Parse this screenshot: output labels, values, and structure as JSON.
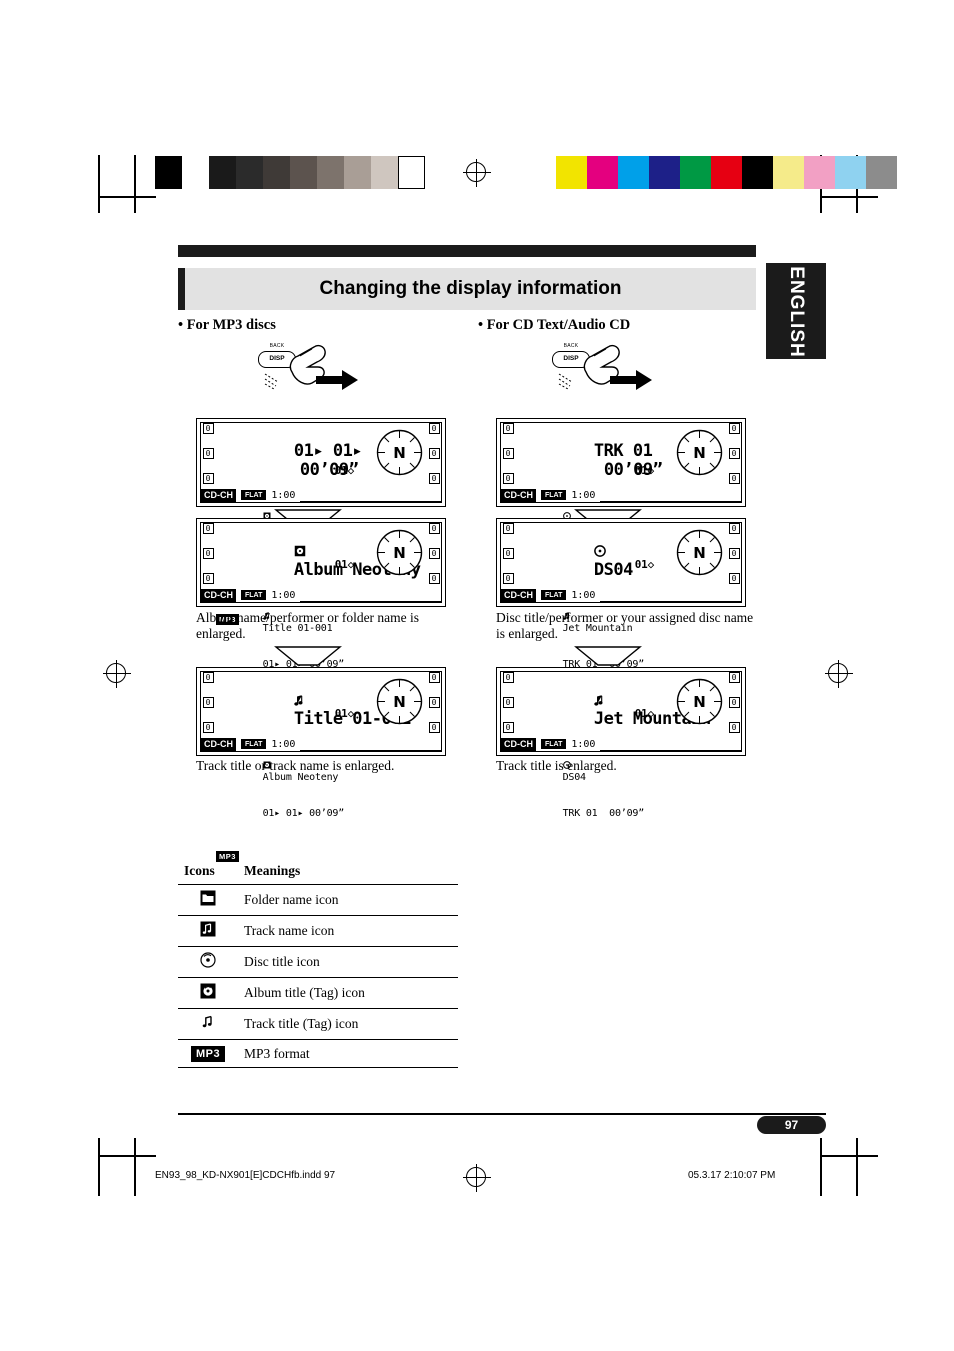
{
  "header": {
    "title": "Changing the display information",
    "language_tab": "ENGLISH"
  },
  "sections": {
    "left_label": "• For MP3 discs",
    "right_label": "• For CD Text/Audio CD"
  },
  "button": {
    "line1": "BACK",
    "line2": "DISP"
  },
  "left_column": {
    "panels": [
      {
        "line_big": "01▸ 01▸",
        "line_big_time": "00’09”",
        "line2": "Album Neoteny",
        "line3": "Title 01-001",
        "right_num": "01◇",
        "format": "MP3",
        "source": "CD-CH",
        "eq": "FLAT",
        "time": "1:00"
      },
      {
        "line_big": "Album Neoteny",
        "line2": "Title 01-001",
        "line3": "01▸ 01▸ 00’09”",
        "right_num": "01◇",
        "format": "MP3",
        "source": "CD-CH",
        "eq": "FLAT",
        "time": "1:00"
      },
      {
        "line_big": "Title 01-001",
        "line2": "Album Neoteny",
        "line3": "01▸ 01▸ 00’09”",
        "right_num": "01◇",
        "format": "MP3",
        "source": "CD-CH",
        "eq": "FLAT",
        "time": "1:00"
      }
    ],
    "captions": [
      "Album name/performer or folder name is enlarged.",
      "Track title or track name is enlarged."
    ]
  },
  "right_column": {
    "panels": [
      {
        "line_big": "TRK 01",
        "line_big_time": "00’09”",
        "line2": "DS04",
        "line3": "Jet Mountain",
        "right_num": "01◇",
        "source": "CD-CH",
        "eq": "FLAT",
        "time": "1:00"
      },
      {
        "line_big": "DS04",
        "line2": "Jet Mountain",
        "line3": "TRK 01  00’09”",
        "right_num": "01◇",
        "source": "CD-CH",
        "eq": "FLAT",
        "time": "1:00"
      },
      {
        "line_big": "Jet Mountain",
        "line2": "DS04",
        "line3": "TRK 01  00’09”",
        "right_num": "01◇",
        "source": "CD-CH",
        "eq": "FLAT",
        "time": "1:00"
      }
    ],
    "captions": [
      "Disc title/performer or your assigned disc name is enlarged.",
      "Track title is enlarged."
    ]
  },
  "panel_side_digits": {
    "left": [
      "0",
      "0",
      "0"
    ],
    "right": [
      "0",
      "0",
      "0"
    ]
  },
  "icon_table": {
    "headers": [
      "Icons",
      "Meanings"
    ],
    "rows": [
      {
        "icon": "folder-icon",
        "meaning": "Folder name icon"
      },
      {
        "icon": "track-name-icon",
        "meaning": "Track name icon"
      },
      {
        "icon": "disc-title-icon",
        "meaning": "Disc title icon"
      },
      {
        "icon": "album-title-tag-icon",
        "meaning": "Album title (Tag) icon"
      },
      {
        "icon": "track-title-tag-icon",
        "meaning": "Track title (Tag) icon"
      },
      {
        "icon": "mp3-format-icon",
        "meaning": "MP3 format"
      }
    ]
  },
  "footer": {
    "page_number": "97",
    "file_info": "EN93_98_KD-NX901[E]CDCHfb.indd   97",
    "print_info": "05.3.17   2:10:07 PM"
  },
  "colors": {
    "ink": "#000000",
    "header_bg": "#e2e2e2",
    "tab_bg": "#1b1b1b"
  }
}
